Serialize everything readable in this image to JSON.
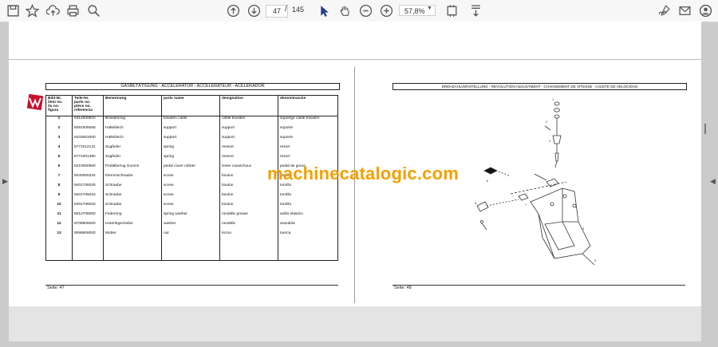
{
  "toolbar": {
    "page_current": "47",
    "page_separator": "/",
    "page_total": "145",
    "zoom": "57,8%"
  },
  "left_page": {
    "title": "GASBETÄTIGUNG - ACCELERATOR - ACCELERATEUR - ACELERADOR",
    "headers": [
      "Bild-Nr.\nitem no.\nilu no.\nfigura",
      "Teile-Nr.\nparts no.\npièce no.\nreferencia",
      "Benennung",
      "parts name",
      "designation",
      "denominación"
    ],
    "rows": [
      [
        "1",
        "5314500810",
        "Bowdenzug",
        "bowden cable",
        "câble bowden",
        "soportge cable bowden"
      ],
      [
        "2",
        "6091505065",
        "Halteblech",
        "support",
        "support",
        "soporte"
      ],
      [
        "3",
        "6103061000",
        "Halteblech",
        "support",
        "support",
        "soporte"
      ],
      [
        "4",
        "5771012131",
        "Zugfeder",
        "spring",
        "ressort",
        "resort"
      ],
      [
        "5",
        "5771001380",
        "Zugfeder",
        "spring",
        "ressort",
        "resort"
      ],
      [
        "6",
        "5210050660",
        "Pedalbezug Gummi",
        "pedal cover rubber",
        "levier caoutchouc",
        "pedal de goma"
      ],
      [
        "7",
        "5040050334",
        "Klemmschraube",
        "screw",
        "boulon",
        "tornillo"
      ],
      [
        "8",
        "9401706025",
        "Schraube",
        "screw",
        "boulon",
        "tornillo"
      ],
      [
        "9",
        "9401706016",
        "Schraube",
        "screw",
        "boulon",
        "tornillo"
      ],
      [
        "10",
        "9401706020",
        "Schraube",
        "screw",
        "boulon",
        "tornillo"
      ],
      [
        "11",
        "9012708000",
        "Federring",
        "spring washer",
        "rondelle grower",
        "anillo elástico"
      ],
      [
        "12",
        "9708906000",
        "Unterlegscheibe",
        "washer",
        "rondelle",
        "arandela"
      ],
      [
        "13",
        "9098606000",
        "Mutter",
        "nut",
        "écrou",
        "tuerca"
      ]
    ],
    "footer": "Seite: 47"
  },
  "right_page": {
    "title": "DREHZAHLVERSTELLUNG - REVOLUTION ADJUSTMENT - CHANGEMENT DE VITESSE - AJUSTE DE VELOCIDAD",
    "footer": "Seite: 48"
  },
  "watermark": "machinecatalogic.com"
}
